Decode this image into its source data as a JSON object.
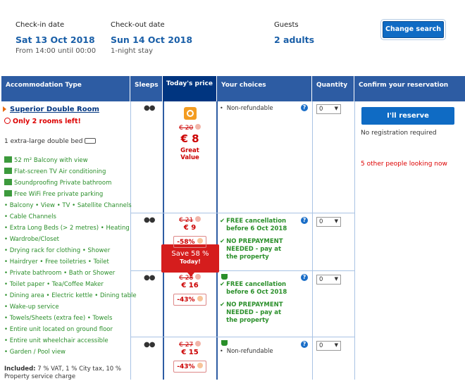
{
  "booking": {
    "checkin": {
      "label": "Check-in date",
      "date": "Sat 13 Oct 2018",
      "sub": "From 14:00 until 00:00"
    },
    "checkout": {
      "label": "Check-out date",
      "date": "Sun 14 Oct 2018",
      "sub": "1-night stay"
    },
    "guests": {
      "label": "Guests",
      "value": "2 adults"
    },
    "change_label": "Change search"
  },
  "headers": [
    "Accommodation Type",
    "Sleeps",
    "Today's price",
    "Your choices",
    "Quantity",
    "Confirm your reservation"
  ],
  "room": {
    "title": "Superior Double Room",
    "only": "Only 2 rooms left!",
    "bed": "1 extra-large double bed",
    "feature_lines": [
      "52 m²  Balcony with view",
      "Flat-screen TV  Air conditioning",
      "Soundproofing  Private bathroom",
      "Free WiFi  Free private parking",
      "• Balcony • View • TV • Satellite Channels",
      "• Cable Channels",
      "• Extra Long Beds (> 2 metres) • Heating",
      "• Wardrobe/Closet",
      "• Drying rack for clothing • Shower",
      "• Hairdryer • Free toiletries • Toilet",
      "• Private bathroom • Bath or Shower",
      "• Toilet paper • Tea/Coffee Maker",
      "• Dining area • Electric kettle • Dining table",
      "• Wake-up service",
      "• Towels/Sheets (extra fee) • Towels",
      "• Entire unit located on ground floor",
      "• Entire unit wheelchair accessible",
      "• Garden / Pool view"
    ],
    "included_label": "Included:",
    "included_text": "7 % VAT, 1 % City tax, 10 % Property service charge"
  },
  "rates": [
    {
      "old": "€ 20",
      "price": "€ 8",
      "badge": "Great Value",
      "save": "Save 58 %",
      "today": "Today!",
      "choice": [
        "Non-refundable"
      ],
      "qty": "0"
    },
    {
      "old": "€ 21",
      "price": "€ 9",
      "pct": "-58%",
      "choice": [
        "FREE cancellation before 6 Oct 2018",
        "NO PREPAYMENT NEEDED - pay at the property"
      ],
      "qty": "0"
    },
    {
      "old": "€ 28",
      "price": "€ 16",
      "pct": "-43%",
      "choice": [
        "FREE cancellation before 6 Oct 2018",
        "NO PREPAYMENT NEEDED - pay at the property"
      ],
      "qty": "0"
    },
    {
      "old": "€ 27",
      "price": "€ 15",
      "pct": "-43%",
      "choice": [
        "Non-refundable"
      ],
      "qty": "0"
    }
  ],
  "reserve": {
    "button": "I'll reserve",
    "noreg": "No registration required",
    "looking": "5 other people looking now"
  }
}
